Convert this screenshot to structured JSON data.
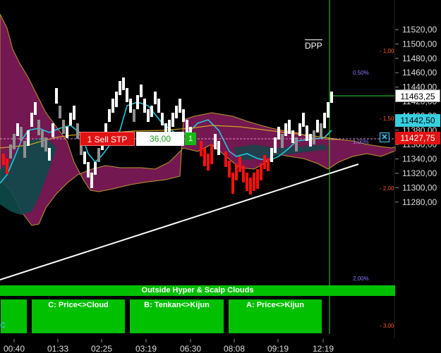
{
  "price_axis": {
    "labels": [
      "11520,00",
      "11500,00",
      "11480,00",
      "11460,00",
      "11440,00",
      "11420,00",
      "11400,00",
      "11380,00",
      "11360,00",
      "11340,00",
      "11320,00",
      "11300,00",
      "11280,00"
    ]
  },
  "time_axis": {
    "labels": [
      "00:40",
      "01:33",
      "02:25",
      "03:19",
      "06:30",
      "08:08",
      "09:19",
      "12:19"
    ]
  },
  "price_tags": {
    "last": "11463,25",
    "ask": "11442,50",
    "bid": "11427,75"
  },
  "order": {
    "label": "1 Sell STP",
    "quantity": "36,00",
    "count": "1"
  },
  "pct_labels": {
    "p050": "0.50%",
    "p100": "1,00%",
    "p200": "2,00%",
    "n100": "- 1,00",
    "n150": "- 1,50",
    "n200": "- 2,00",
    "n300": "- 3,00"
  },
  "dpp": "DPP",
  "banner": "Outside Hyper & Scalp Clouds",
  "buttons": {
    "c": "C: Price<>Cloud",
    "b": "B: Tenkan<>Kijun",
    "a": "A: Price<>Kijun"
  },
  "corner_mark": "C",
  "colors": {
    "background": "#000000",
    "cloud": "#7a1a55",
    "cloud_teal": "#0e3a3a",
    "tenkan": "#22c8e0",
    "kijun": "#d4a020",
    "up_bar": "#ffffff",
    "down_bar": "#ff1010",
    "neutral_bar": "#909090",
    "green": "#00c000",
    "vline": "#22dd22"
  }
}
